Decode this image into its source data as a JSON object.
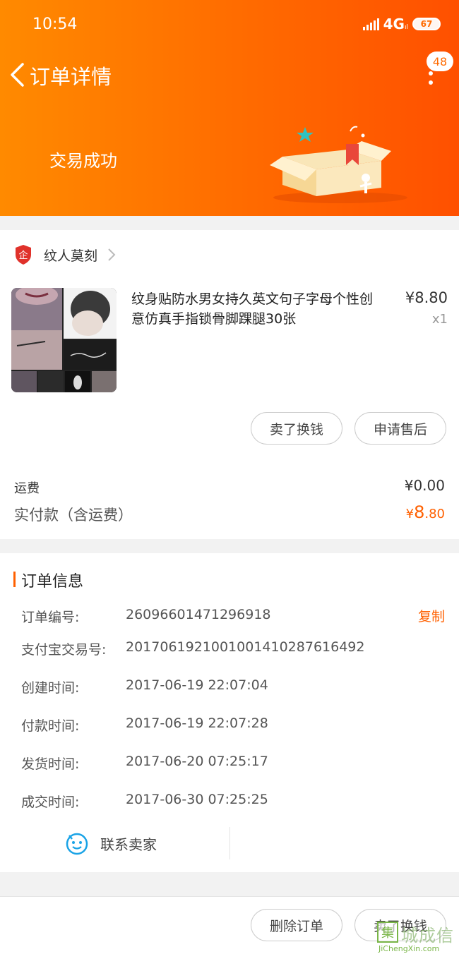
{
  "status_bar": {
    "time": "10:54",
    "network": "4G",
    "network_sub": "ıl",
    "battery": "67"
  },
  "nav": {
    "title": "订单详情",
    "badge_count": "48"
  },
  "order_status": {
    "text": "交易成功"
  },
  "shop": {
    "name": "纹人莫刻"
  },
  "product": {
    "title": "纹身贴防水男女持久英文句子字母个性创意仿真手指锁骨脚踝腿30张",
    "price": "¥8.80",
    "quantity": "x1",
    "actions": {
      "sell_label": "卖了换钱",
      "after_sales_label": "申请售后"
    }
  },
  "fees": {
    "shipping_label": "运费",
    "shipping_value": "¥0.00",
    "paid_label": "实付款（含运费）",
    "paid_currency": "¥",
    "paid_integer": "8",
    "paid_decimal": ".80"
  },
  "order_info": {
    "section_title": "订单信息",
    "copy_label": "复制",
    "rows": [
      {
        "label": "订单编号:",
        "value": "26096601471296918"
      },
      {
        "label": "支付宝交易号:",
        "value": "2017061921001001410287616492"
      },
      {
        "label": "创建时间:",
        "value": "2017-06-19 22:07:04"
      },
      {
        "label": "付款时间:",
        "value": "2017-06-19 22:07:28"
      },
      {
        "label": "发货时间:",
        "value": "2017-06-20 07:25:17"
      },
      {
        "label": "成交时间:",
        "value": "2017-06-30 07:25:25"
      }
    ],
    "contact_label": "联系卖家"
  },
  "bottom_bar": {
    "delete_label": "删除订单",
    "sell_label": "卖了换钱"
  },
  "watermark": {
    "logo": "集",
    "text": "城成信",
    "sub": "JiChengXin.com"
  },
  "colors": {
    "accent": "#ff6000",
    "header_start": "#ff8a00",
    "header_end": "#ff5000"
  }
}
